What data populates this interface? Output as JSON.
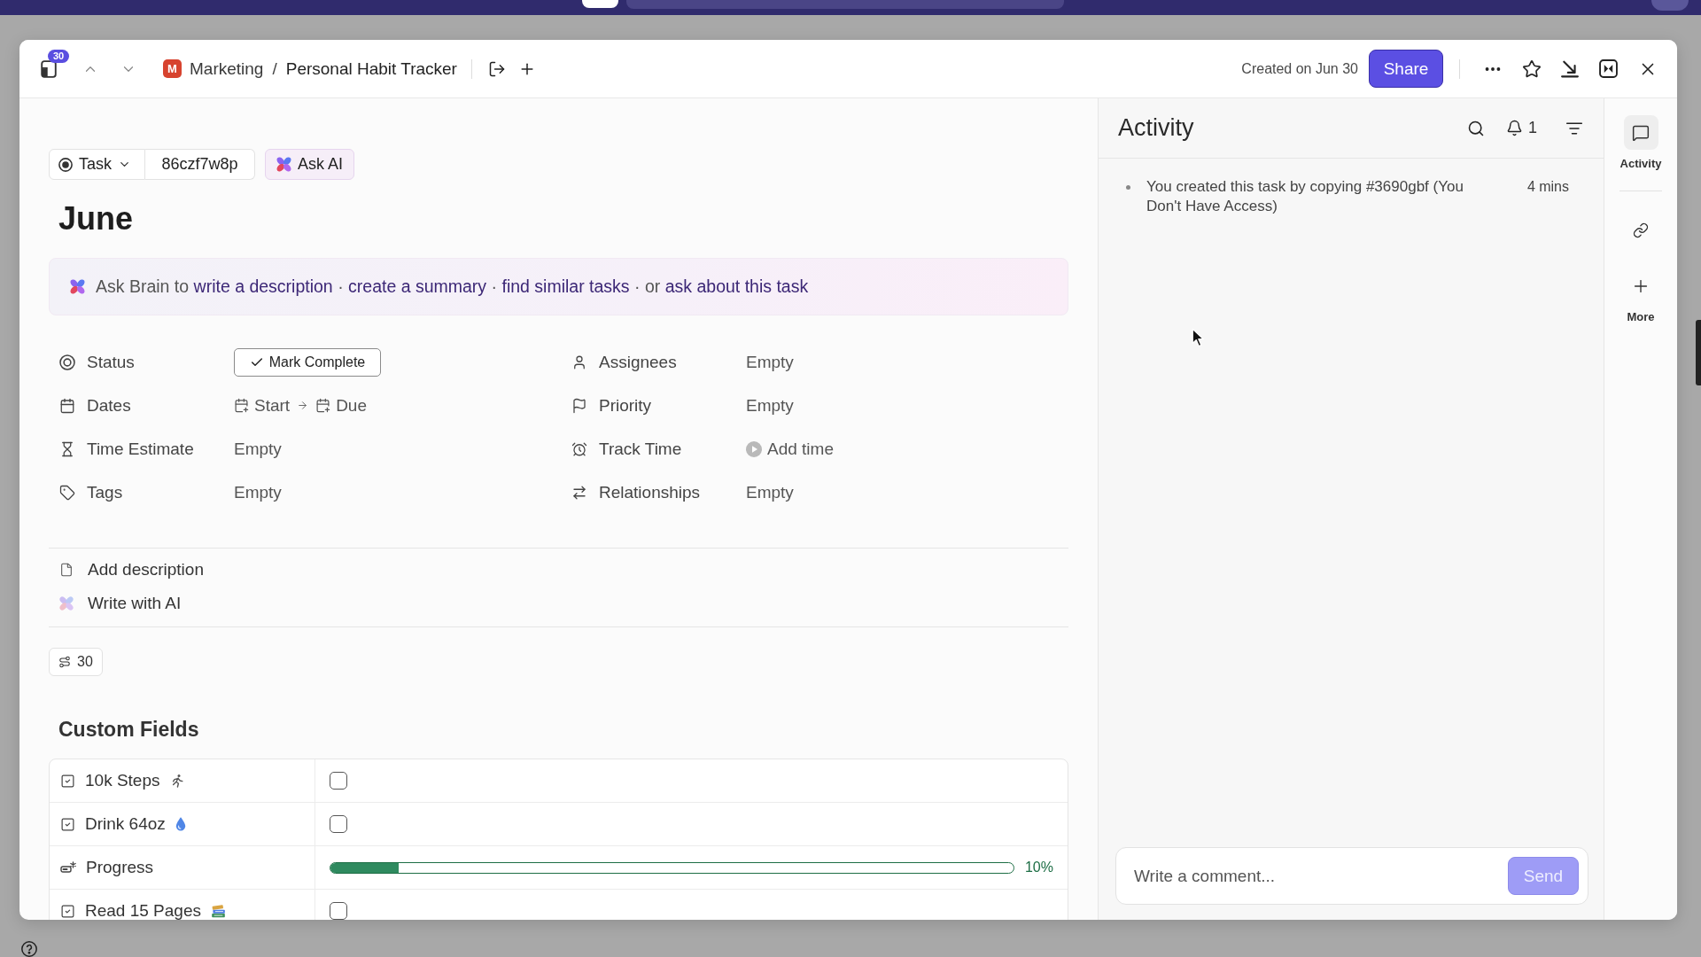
{
  "header": {
    "inbox_count": "30",
    "breadcrumb": {
      "space_initial": "M",
      "space": "Marketing",
      "separator": "/",
      "list": "Personal Habit Tracker"
    },
    "created": "Created on Jun 30",
    "share": "Share"
  },
  "task": {
    "type": "Task",
    "id": "86czf7w8p",
    "ask_ai": "Ask AI",
    "title": "June"
  },
  "ask_brain": {
    "segments": [
      {
        "kind": "plain",
        "text": "Ask Brain to"
      },
      {
        "kind": "link",
        "text": "write a description"
      },
      {
        "kind": "plain",
        "text": "·"
      },
      {
        "kind": "link",
        "text": "create a summary"
      },
      {
        "kind": "plain",
        "text": "·"
      },
      {
        "kind": "link",
        "text": "find similar tasks"
      },
      {
        "kind": "plain",
        "text": "· or"
      },
      {
        "kind": "link",
        "text": "ask about this task"
      }
    ]
  },
  "fields": [
    {
      "kind": "status",
      "label": "Status",
      "value": "Mark Complete"
    },
    {
      "kind": "assignees",
      "label": "Assignees",
      "value": "Empty"
    },
    {
      "kind": "dates",
      "label": "Dates",
      "start": "Start",
      "due": "Due"
    },
    {
      "kind": "priority",
      "label": "Priority",
      "value": "Empty"
    },
    {
      "kind": "estimate",
      "label": "Time Estimate",
      "value": "Empty"
    },
    {
      "kind": "timer",
      "label": "Track Time",
      "value": "Add time"
    },
    {
      "kind": "tags",
      "label": "Tags",
      "value": "Empty"
    },
    {
      "kind": "relationships",
      "label": "Relationships",
      "value": "Empty"
    }
  ],
  "description": {
    "add": "Add description",
    "ai": "Write with AI"
  },
  "subtasks": {
    "count": "30"
  },
  "custom_fields": {
    "title": "Custom Fields",
    "rows": [
      {
        "kind": "checkbox",
        "name": "10k Steps",
        "emoji": {
          "kind": "runner"
        },
        "checked": false
      },
      {
        "kind": "checkbox",
        "name": "Drink 64oz",
        "emoji": {
          "kind": "droplet"
        },
        "checked": false
      },
      {
        "kind": "progress",
        "name": "Progress",
        "level": 0.1,
        "reading": "10%"
      },
      {
        "kind": "checkbox",
        "name": "Read 15 Pages",
        "emoji": {
          "kind": "books"
        },
        "checked": false
      }
    ]
  },
  "activity": {
    "title": "Activity",
    "notifications": "1",
    "entries": [
      {
        "text": "You created this task by copying #3690gbf (You Don't Have Access)",
        "time": "4 mins"
      }
    ],
    "comment": {
      "placeholder": "Write a comment...",
      "send": {
        "label": "Send",
        "disabled": true
      }
    }
  },
  "rail": [
    {
      "kind": "comments",
      "label": "Activity",
      "selected": true
    },
    {
      "kind": "link",
      "selected": false
    },
    {
      "kind": "add",
      "label": "More",
      "selected": false
    }
  ]
}
